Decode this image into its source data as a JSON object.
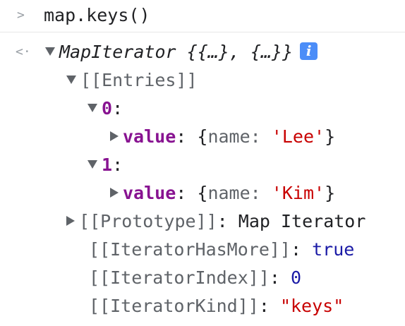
{
  "console": {
    "input": {
      "prompt": ">",
      "expression": "map.keys()"
    },
    "result": {
      "return_marker": "<·",
      "summary": "MapIterator {{…}, {…}}",
      "info_badge": "i",
      "entries_label": "[[Entries]]",
      "entries": [
        {
          "index_label": "0",
          "sep": ":",
          "property": "value",
          "prop_sep": ":",
          "object_open": "{",
          "field": "name",
          "field_sep": ":",
          "field_value": "'Lee'",
          "object_close": "}"
        },
        {
          "index_label": "1",
          "sep": ":",
          "property": "value",
          "prop_sep": ":",
          "object_open": "{",
          "field": "name",
          "field_sep": ":",
          "field_value": "'Kim'",
          "object_close": "}"
        }
      ],
      "prototype_label": "[[Prototype]]",
      "prototype_value": "Map Iterator",
      "has_more_label": "[[IteratorHasMore]]",
      "has_more_value": "true",
      "index_label": "[[IteratorIndex]]",
      "index_value": "0",
      "kind_label": "[[IteratorKind]]",
      "kind_value": "\"keys\""
    }
  },
  "colors": {
    "key_purple": "#881391",
    "string_red": "#c80000",
    "value_blue": "#1a1aa6",
    "info_badge": "#4b8df8"
  }
}
